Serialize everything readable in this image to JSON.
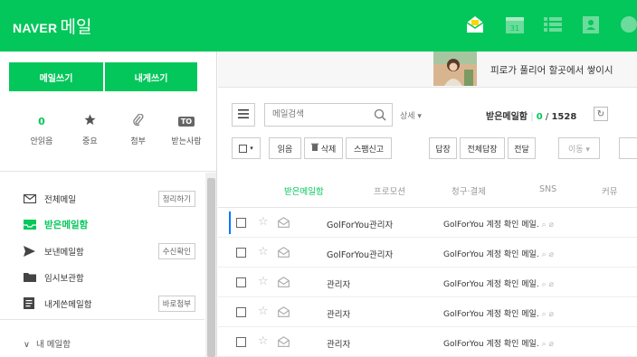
{
  "header": {
    "brand_naver": "NAVER",
    "brand_mail": "메일",
    "icons": [
      "envelope-open-icon",
      "calendar-31-icon",
      "list-icon",
      "contacts-icon",
      "extra-icon"
    ]
  },
  "sidebar": {
    "write_button": "메일쓰기",
    "self_write_button": "내게쓰기",
    "quick": [
      {
        "count": "0",
        "label": "안읽음"
      },
      {
        "label": "중요"
      },
      {
        "label": "첨부"
      },
      {
        "badge": "TO",
        "label": "받는사람"
      }
    ],
    "folders": [
      {
        "name": "전체메일",
        "button": "정리하기"
      },
      {
        "name": "받은메일함",
        "active": true
      },
      {
        "name": "보낸메일함",
        "button": "수신확인"
      },
      {
        "name": "임시보관함"
      },
      {
        "name": "내게쓴메일함",
        "button": "바로첨부"
      }
    ],
    "my_mailbox": "내 메일함"
  },
  "banner": {
    "text": "피로가 풀리어 할곳에서 쌓이시"
  },
  "search": {
    "placeholder": "메일검색",
    "detail": "상세 ▾",
    "inbox_label": "받은메일함",
    "unread": "0",
    "total": "1528",
    "separator": "|"
  },
  "toolbar": {
    "read": "읽음",
    "delete": "삭제",
    "spam": "스팸신고",
    "reply": "답장",
    "reply_all": "전체답장",
    "forward": "전달",
    "move": "이동 ▾"
  },
  "tabs": [
    "받은메일함",
    "프로모션",
    "청구·결제",
    "SNS",
    "커뮤"
  ],
  "mails": [
    {
      "sender": "GolForYou관리자",
      "subject": "GolForYou 계정 확인 메일."
    },
    {
      "sender": "GolForYou관리자",
      "subject": "GolForYou 계정 확인 메일."
    },
    {
      "sender": "관리자",
      "subject": "GolForYou 계정 확인 메일."
    },
    {
      "sender": "관리자",
      "subject": "GolForYou 계정 확인 메일."
    },
    {
      "sender": "관리자",
      "subject": "GolForYou 계정 확인 메일."
    }
  ],
  "colors": {
    "brand": "#03c75a",
    "accent_blue": "#0078ff"
  }
}
